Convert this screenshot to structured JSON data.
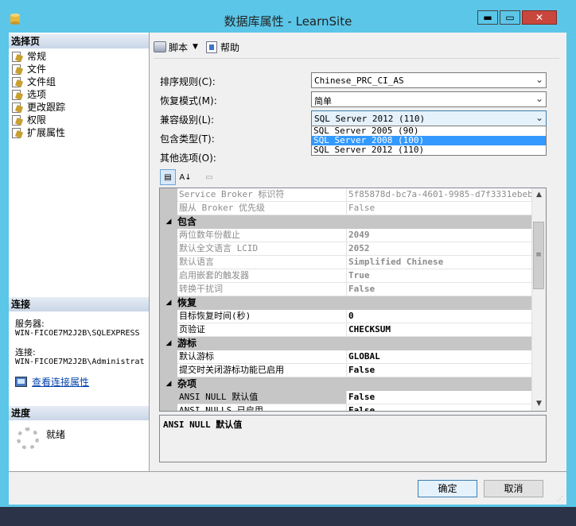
{
  "window": {
    "title": "数据库属性 - LearnSite",
    "min": "▬",
    "max": "▭",
    "close": "✕"
  },
  "left": {
    "select_page_header": "选择页",
    "pages": [
      {
        "label": "常规"
      },
      {
        "label": "文件"
      },
      {
        "label": "文件组"
      },
      {
        "label": "选项"
      },
      {
        "label": "更改跟踪"
      },
      {
        "label": "权限"
      },
      {
        "label": "扩展属性"
      }
    ],
    "connection_header": "连接",
    "server_label": "服务器:",
    "server_value": "WIN-FICOE7M2J2B\\SQLEXPRESS",
    "connection_label": "连接:",
    "connection_value": "WIN-FICOE7M2J2B\\Administrat",
    "view_conn_link": "查看连接属性",
    "progress_header": "进度",
    "status": "就绪"
  },
  "toolbar": {
    "script": "脚本",
    "help": "帮助"
  },
  "form": {
    "collation_label": "排序规则(C):",
    "collation_value": "Chinese_PRC_CI_AS",
    "recovery_label": "恢复模式(M):",
    "recovery_value": "简单",
    "compat_label": "兼容级别(L):",
    "compat_value": "SQL Server 2012 (110)",
    "containment_label": "包含类型(T):",
    "other_label": "其他选项(O):",
    "compat_options": [
      "SQL Server 2005 (90)",
      "SQL Server 2008 (100)",
      "SQL Server 2012 (110)"
    ]
  },
  "grid": {
    "r1": {
      "name": "Service Broker 标识符",
      "value": "5f85878d-bc7a-4601-9985-d7f3331ebebd"
    },
    "r2": {
      "name": "服从 Broker 优先级",
      "value": "False"
    },
    "cat1": "包含",
    "r3": {
      "name": "两位数年份截止",
      "value": "2049"
    },
    "r4": {
      "name": "默认全文语言 LCID",
      "value": "2052"
    },
    "r5": {
      "name": "默认语言",
      "value": "Simplified Chinese"
    },
    "r6": {
      "name": "启用嵌套的触发器",
      "value": "True"
    },
    "r7": {
      "name": "转换干扰词",
      "value": "False"
    },
    "cat2": "恢复",
    "r8": {
      "name": "目标恢复时间(秒)",
      "value": "0"
    },
    "r9": {
      "name": "页验证",
      "value": "CHECKSUM"
    },
    "cat3": "游标",
    "r10": {
      "name": "默认游标",
      "value": "GLOBAL"
    },
    "r11": {
      "name": "提交时关闭游标功能已启用",
      "value": "False"
    },
    "cat4": "杂项",
    "r12": {
      "name": "ANSI NULL 默认值",
      "value": "False"
    },
    "r13": {
      "name": "ANSI NULLS 已启用",
      "value": "False"
    }
  },
  "description": "ANSI NULL 默认值",
  "buttons": {
    "ok": "确定",
    "cancel": "取消"
  }
}
